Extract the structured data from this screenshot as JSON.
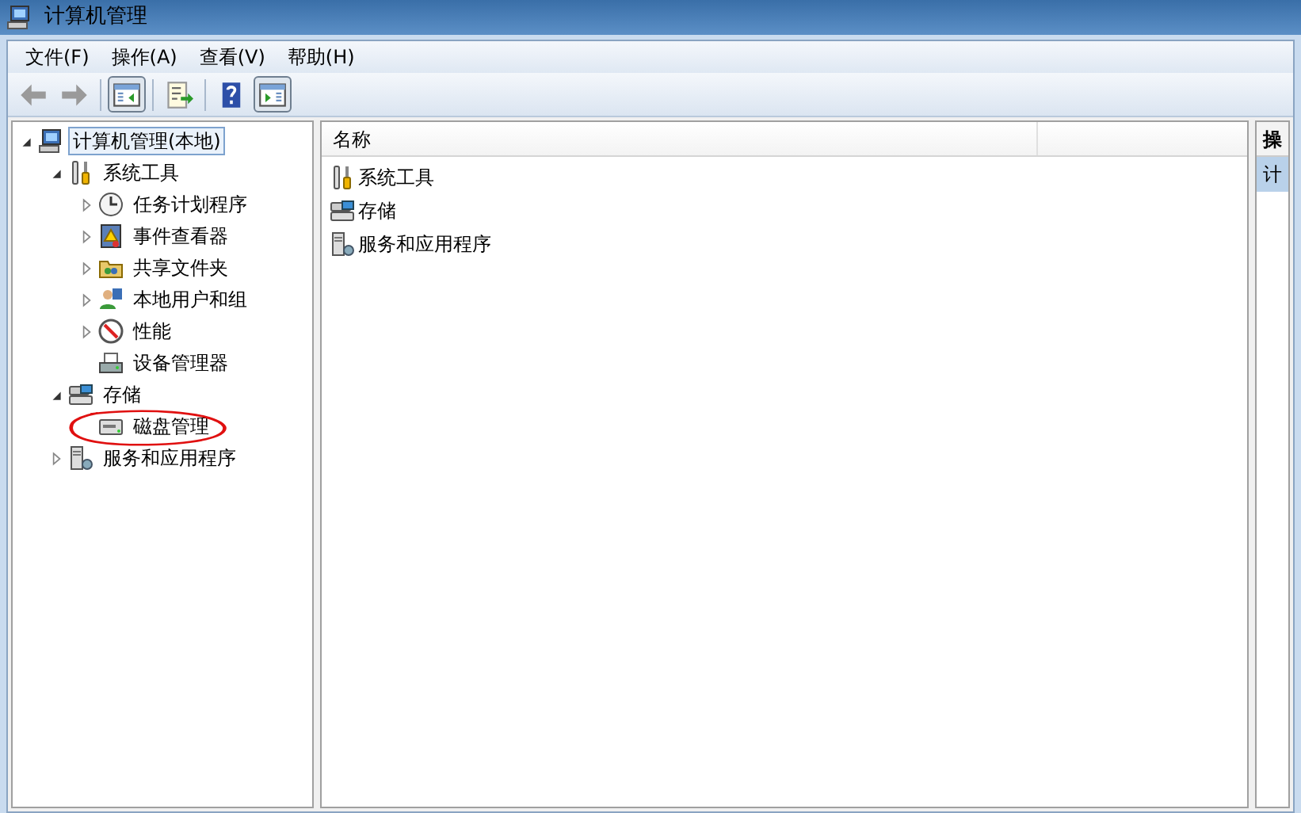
{
  "window": {
    "title": "计算机管理"
  },
  "menu": [
    {
      "label": "文件(F)"
    },
    {
      "label": "操作(A)"
    },
    {
      "label": "查看(V)"
    },
    {
      "label": "帮助(H)"
    }
  ],
  "toolbar": [
    {
      "kind": "back",
      "disabled": true,
      "pressed": false
    },
    {
      "kind": "forward",
      "disabled": true,
      "pressed": false
    },
    {
      "kind": "tree-toggle",
      "pressed": true
    },
    {
      "kind": "export",
      "pressed": false
    },
    {
      "kind": "help",
      "pressed": false
    },
    {
      "kind": "action-toggle",
      "pressed": true
    }
  ],
  "tree": [
    {
      "label": "计算机管理(本地)",
      "kind": "computer",
      "selected": true,
      "expanded": true,
      "children": [
        {
          "label": "系统工具",
          "kind": "tools",
          "selected": false,
          "expanded": true,
          "children": [
            {
              "label": "任务计划程序",
              "kind": "clock",
              "selected": false,
              "expanded": false
            },
            {
              "label": "事件查看器",
              "kind": "event",
              "selected": false,
              "expanded": false
            },
            {
              "label": "共享文件夹",
              "kind": "share",
              "selected": false,
              "expanded": false
            },
            {
              "label": "本地用户和组",
              "kind": "users",
              "selected": false,
              "expanded": false
            },
            {
              "label": "性能",
              "kind": "perf",
              "selected": false,
              "expanded": false
            },
            {
              "label": "设备管理器",
              "kind": "device",
              "selected": false
            }
          ]
        },
        {
          "label": "存储",
          "kind": "storage",
          "selected": false,
          "expanded": true,
          "children": [
            {
              "label": "磁盘管理",
              "kind": "disk",
              "selected": false
            }
          ]
        },
        {
          "label": "服务和应用程序",
          "kind": "services",
          "selected": false,
          "expanded": false
        }
      ]
    }
  ],
  "list": {
    "columns": [
      "名称"
    ],
    "items": [
      {
        "label": "系统工具",
        "kind": "tools"
      },
      {
        "label": "存储",
        "kind": "storage"
      },
      {
        "label": "服务和应用程序",
        "kind": "services"
      }
    ]
  },
  "actions": {
    "header": "操",
    "items": [
      {
        "label": "计",
        "selected": true
      }
    ]
  },
  "annotation": {
    "kind": "circle"
  }
}
